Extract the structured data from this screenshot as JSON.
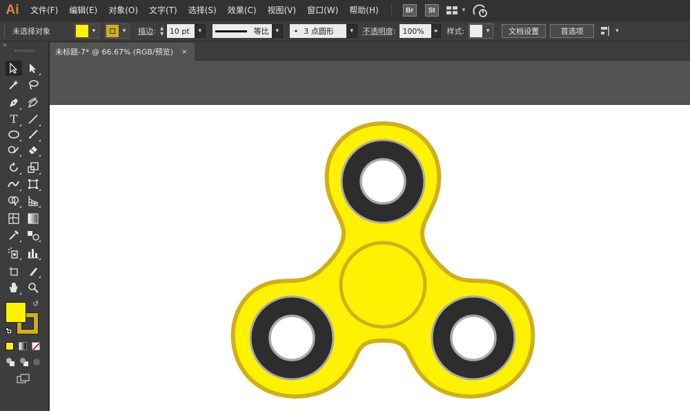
{
  "app": {
    "logo": "Ai",
    "menu": [
      "文件(F)",
      "编辑(E)",
      "对象(O)",
      "文字(T)",
      "选择(S)",
      "效果(C)",
      "视图(V)",
      "窗口(W)",
      "帮助(H)"
    ],
    "bridge_badge": "Br",
    "stock_badge": "St"
  },
  "control_bar": {
    "selection_status": "未选择对象",
    "fill_color": "#fff200",
    "stroke_color": "#d1ae1c",
    "stroke_label": "描边",
    "stroke_weight": "10 pt",
    "profile_label": "等比",
    "brush_label": "3 点圆形",
    "brush_dot": "•",
    "opacity_label": "不透明度",
    "opacity_value": "100%",
    "style_label": "样式",
    "doc_setup_button": "文档设置",
    "preferences_button": "首选项"
  },
  "document": {
    "tab_title": "未标题-7* @ 66.67% (RGB/预览)",
    "close_glyph": "×"
  },
  "tools_panel": {
    "fill_swatch": "#fff200",
    "stroke_swatch": "#d1ae1c",
    "collapse_glyph": "«"
  },
  "artwork": {
    "outer_color": "#fff200",
    "outline_color": "#d1ae1c",
    "bearing_color": "#2d2d2d",
    "ring_color": "#a9a9a9",
    "hole_color": "#ffffff"
  }
}
